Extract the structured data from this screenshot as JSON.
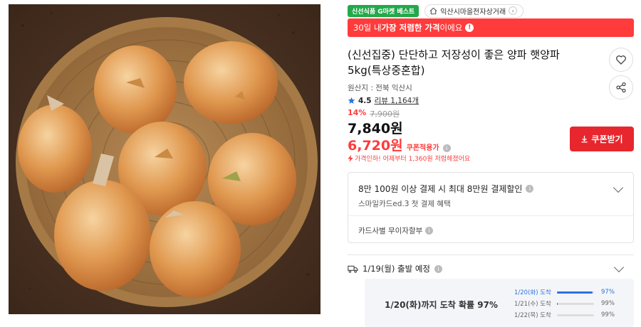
{
  "image": {
    "alt": "onions in a woven basket"
  },
  "badges": {
    "best": "신선식품 G마켓 베스트"
  },
  "store": {
    "name": "익산시마을전자상거래",
    "chevron": "›"
  },
  "promo": {
    "pre": "30일 내 ",
    "bold": "가장 저렴한 가격",
    "post": "이에요",
    "icon": "!"
  },
  "product": {
    "title": "(신선집중) 단단하고 저장성이 좋은 양파 햇양파 5kg(특상중혼합)",
    "origin": "원산지 : 전북 익산시",
    "rating": "4.5",
    "reviews": "리뷰 1,164개"
  },
  "price": {
    "discount_pct": "14%",
    "original": "7,900원",
    "sale": "7,840원",
    "coupon_price": "6,720원",
    "coupon_applied": "쿠폰적용가",
    "price_drop": "가격인하! 어제부터 1,360원 저렴해졌어요"
  },
  "coupon_button": {
    "label": "쿠폰받기"
  },
  "card": {
    "main": "8만 100원 이상 결제 시 최대 8만원 결제할인",
    "sub": "스마일카드ed.3 첫 결제 혜택",
    "installment": "카드사별 무이자할부"
  },
  "shipping": {
    "departure": "1/19(월) 출발 예정",
    "arrival": "1/20(화)까지 도착 확률 97%",
    "distribution": [
      {
        "label": "1/20(화) 도착",
        "pct": "97%",
        "value": 0.97,
        "active": true
      },
      {
        "label": "1/21(수) 도착",
        "pct": "99%",
        "value": 0.02,
        "active": false
      },
      {
        "label": "1/22(목) 도착",
        "pct": "99%",
        "value": 0.0,
        "active": false
      }
    ]
  },
  "icons": [
    "home-icon",
    "heart-icon",
    "share-icon",
    "star-icon",
    "info-icon",
    "lightning-icon",
    "download-icon",
    "truck-icon",
    "chevron-down-icon"
  ],
  "colors": {
    "accent_red": "#ff3b3b",
    "button_red": "#e8262d",
    "badge_green": "#22a94a",
    "blue": "#2a74e0"
  }
}
